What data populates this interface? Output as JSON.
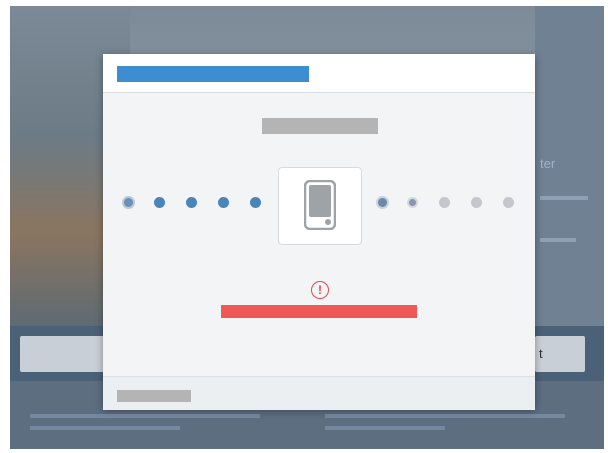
{
  "background": {
    "right_link_glyph": "ter",
    "band_right_glyph": "t"
  },
  "modal": {
    "accent_color": "#3c8ed1",
    "error_color": "#f05757",
    "progress": {
      "steps_completed": 5,
      "steps_remaining": 5
    },
    "device_icon": "tablet-icon",
    "warning_icon_glyph": "!",
    "warning_icon": "exclamation-circle-icon"
  }
}
